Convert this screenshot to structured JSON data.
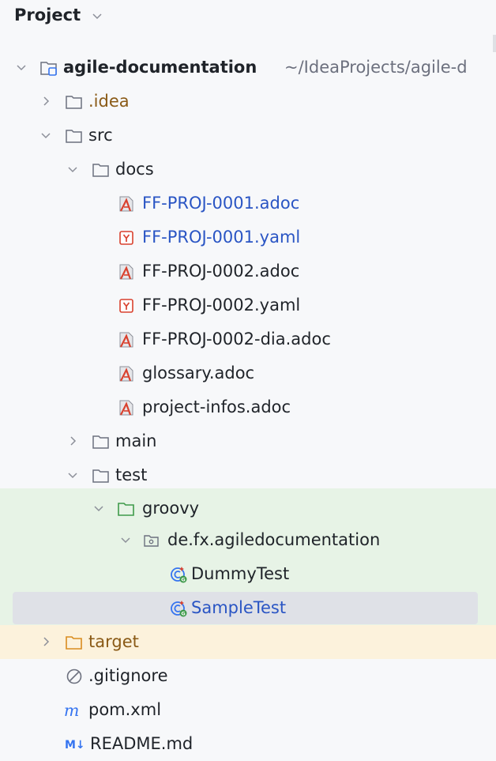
{
  "panel": {
    "title": "Project"
  },
  "tree": {
    "root": {
      "label": "agile-documentation",
      "path": "~/IdeaProjects/agile-d"
    },
    "idea": "idea_placeholder",
    "items": {
      "idea": ".idea",
      "src": "src",
      "docs": "docs",
      "ff1_adoc": "FF-PROJ-0001.adoc",
      "ff1_yaml": "FF-PROJ-0001.yaml",
      "ff2_adoc": "FF-PROJ-0002.adoc",
      "ff2_yaml": "FF-PROJ-0002.yaml",
      "ff2_dia": "FF-PROJ-0002-dia.adoc",
      "glossary": "glossary.adoc",
      "infos": "project-infos.adoc",
      "main": "main",
      "test": "test",
      "groovy": "groovy",
      "package": "de.fx.agiledocumentation",
      "dummy": "DummyTest",
      "sample": "SampleTest",
      "target": "target",
      "gitignore": ".gitignore",
      "pom": "pom.xml",
      "readme": "README.md"
    },
    "icon_glyphs": {
      "yaml": "Y",
      "maven": "m",
      "markdown": "M↓",
      "groovy": "G"
    }
  },
  "colors": {
    "modified_blue": "#2a55c4",
    "excluded_brown": "#8a5a16",
    "test_green_bg": "#e7f3e6",
    "excluded_yellow_bg": "#fcf2dc",
    "selection": "#dfe1e7"
  },
  "icons": [
    "chevron-down-icon",
    "chevron-right-icon",
    "module-folder-icon",
    "folder-icon",
    "asciidoc-icon",
    "yaml-icon",
    "package-icon",
    "groovy-class-icon",
    "ignore-icon",
    "maven-icon",
    "markdown-icon"
  ]
}
